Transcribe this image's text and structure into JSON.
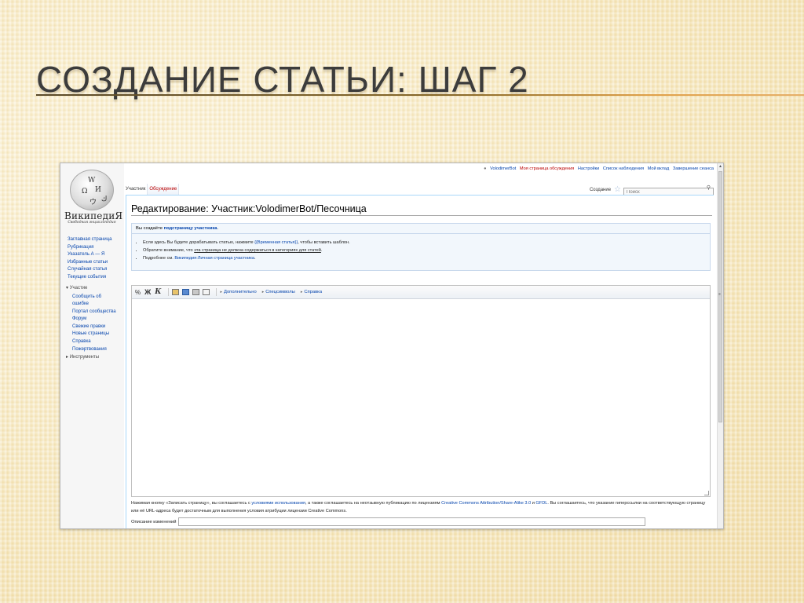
{
  "slide": {
    "title": "Создание статьи: шаг 2"
  },
  "sidebar": {
    "wordmark": "ВикипедиЯ",
    "tagline": "Свободная энциклопедия",
    "logo_glyphs": [
      "W",
      "Ω",
      "И",
      "ウ",
      "ك"
    ],
    "nav": [
      "Заглавная страница",
      "Рубрикация",
      "Указатель А — Я",
      "Избранные статьи",
      "Случайная статья",
      "Текущие события"
    ],
    "participation_header": "Участие",
    "participation": [
      "Сообщить об",
      "ошибке",
      "Портал сообщества",
      "Форум",
      "Свежие правки",
      "Новые страницы",
      "Справка",
      "Пожертвования"
    ],
    "tools_header": "Инструменты"
  },
  "personal": {
    "user": "VolodimerBot",
    "talk": "Моя страница обсуждения",
    "settings": "Настройки",
    "watchlist": "Список наблюдения",
    "contributions": "Мой вклад",
    "logout": "Завершение сеанса"
  },
  "tabs": {
    "user": "Участник",
    "talk": "Обсуждение"
  },
  "actions": {
    "create": "Создание"
  },
  "search": {
    "placeholder": "Поиск"
  },
  "page": {
    "heading": "Редактирование: Участник:VolodimerBot/Песочница"
  },
  "notice": {
    "head_pre": "Вы создаёте ",
    "head_link": "подстраницу участника",
    "head_post": ".",
    "b1_pre": "Если здесь Вы будете дорабатывать статью, нажмите ",
    "b1_link": "{{Временная статья}}",
    "b1_post": ", чтобы вставить шаблон.",
    "b2_pre": "Обратите внимание, что ",
    "b2_ul": "эта страница не должна содержаться в категориях для статей",
    "b2_post": ".",
    "b3_pre": "Подробнее см. ",
    "b3_link": "Википедия:Личная страница участника",
    "b3_post": "."
  },
  "toolbar": {
    "advanced": "Дополнительно",
    "special": "Спецсимволы",
    "help": "Справка",
    "sig": "%",
    "bold": "Ж",
    "italic": "К"
  },
  "license": {
    "p1": "Нажимая кнопку «Записать страницу», вы соглашаетесь с ",
    "l1": "условиями использования",
    "p2": ", а также соглашаетесь на неотзывную публикацию по лицензиям ",
    "l2": "Creative Commons Attribution/Share-Alike 3.0",
    "p3": " и ",
    "l3": "GFDL",
    "p4": ". Вы соглашаетесь, что указание гиперссылки на соответствующую страницу или её URL-адреса будет достаточным для выполнения условия атрибуции лицензии Creative Commons."
  },
  "summary": {
    "label": "Описание изменений"
  }
}
